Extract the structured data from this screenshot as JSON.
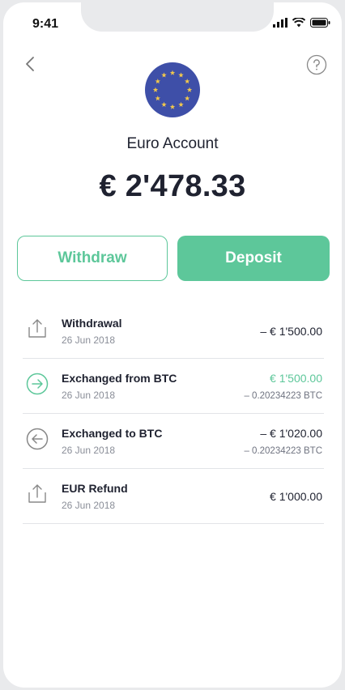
{
  "status": {
    "time": "9:41"
  },
  "account": {
    "name": "Euro Account",
    "balance": "€ 2'478.33"
  },
  "actions": {
    "withdraw": "Withdraw",
    "deposit": "Deposit"
  },
  "colors": {
    "accent": "#5dc79a",
    "text": "#1f2230",
    "flag_blue": "#3e4fa8",
    "flag_stars": "#f2c84b"
  },
  "transactions": [
    {
      "icon": "upload-icon",
      "title": "Withdrawal",
      "date": "26 Jun 2018",
      "amount": "– € 1'500.00",
      "sub": ""
    },
    {
      "icon": "arrow-right-circle-icon",
      "title": "Exchanged from BTC",
      "date": "26 Jun 2018",
      "amount": "€ 1'500.00",
      "sub": "– 0.20234223 BTC"
    },
    {
      "icon": "arrow-left-circle-icon",
      "title": "Exchanged to BTC",
      "date": "26 Jun 2018",
      "amount": "– € 1'020.00",
      "sub": "– 0.20234223 BTC"
    },
    {
      "icon": "upload-icon",
      "title": "EUR Refund",
      "date": "26 Jun 2018",
      "amount": "€ 1'000.00",
      "sub": ""
    }
  ]
}
